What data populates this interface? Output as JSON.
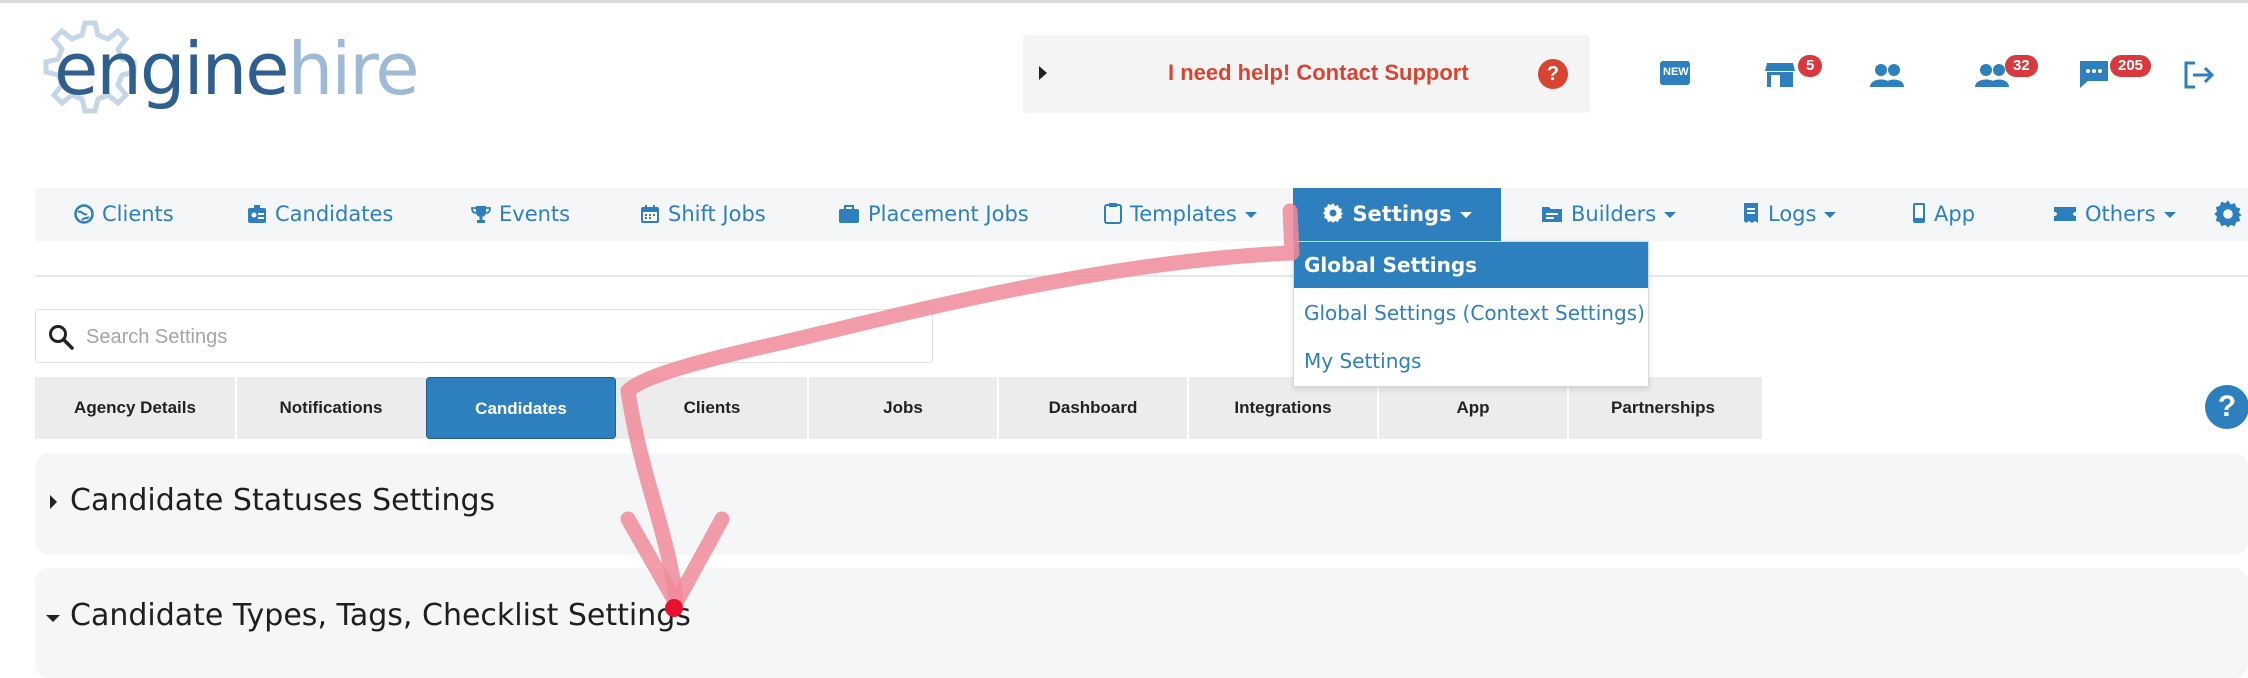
{
  "logo": {
    "brand_primary": "engine",
    "brand_secondary": "hire"
  },
  "support": {
    "label": "I need help! Contact Support",
    "help_glyph": "?"
  },
  "header_icons": [
    {
      "icon": "new-icon",
      "text": "NEW"
    },
    {
      "icon": "store-icon",
      "badge": "5"
    },
    {
      "icon": "users-icon"
    },
    {
      "icon": "user-group-icon",
      "badge": "32"
    },
    {
      "icon": "chat-icon",
      "badge": "205"
    },
    {
      "icon": "logout-icon"
    }
  ],
  "nav": {
    "clients": "Clients",
    "candidates": "Candidates",
    "events": "Events",
    "shift_jobs": "Shift Jobs",
    "placement_jobs": "Placement Jobs",
    "templates": "Templates",
    "settings": "Settings",
    "builders": "Builders",
    "logs": "Logs",
    "app": "App",
    "others": "Others"
  },
  "settings_menu": {
    "items": [
      "Global Settings",
      "Global Settings (Context Settings)",
      "My Settings"
    ],
    "active": "Global Settings"
  },
  "search": {
    "placeholder": "Search Settings",
    "value": ""
  },
  "tabs": {
    "items": [
      "Agency Details",
      "Notifications",
      "Candidates",
      "Clients",
      "Jobs",
      "Dashboard",
      "Integrations",
      "App",
      "Partnerships"
    ],
    "active": "Candidates"
  },
  "help_glyph": "?",
  "sections": {
    "statuses": {
      "title": "Candidate Statuses Settings",
      "expanded": false
    },
    "types": {
      "title": "Candidate Types, Tags, Checklist Settings",
      "expanded": true
    }
  },
  "colors": {
    "accent": "#2e7fbd",
    "support_red": "#d64532",
    "badge_red": "#d9383c",
    "annotation": "#f08a9a",
    "annotation_dot": "#e8112d"
  }
}
